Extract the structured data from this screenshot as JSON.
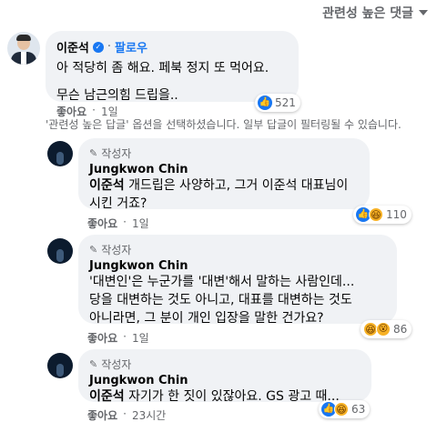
{
  "sort": {
    "label": "관련성 높은 댓글"
  },
  "main_comment": {
    "author": "이준석",
    "follow_label": "팔로우",
    "line1": "아 적당히 좀 해요. 페북 정지 또 먹어요.",
    "line2": "무슨 남근의힘 드립을..",
    "reaction_count": "521",
    "like_label": "좋아요",
    "time": "1일"
  },
  "notice": "'관련성 높은 답글' 옵션을 선택하셨습니다. 일부 답글이 필터링될 수 있습니다.",
  "replies": [
    {
      "author_badge": "작성자",
      "author": "Jungkwon Chin",
      "mention": "이준석",
      "line1_rest": " 개드립은 사양하고, 그거 이준석 대표님이",
      "line2": "시킨 거죠?",
      "reaction_count": "110",
      "like_label": "좋아요",
      "time": "1일"
    },
    {
      "author_badge": "작성자",
      "author": "Jungkwon Chin",
      "line1": "'대변인'은 누군가를 '대변'해서 말하는 사람인데...",
      "line2": "당을 대변하는 것도 아니고, 대표를 대변하는 것도",
      "line3": "아니라면, 그 분이 개인 입장을 말한 건가요?",
      "reaction_count": "86",
      "like_label": "좋아요",
      "time": "1일"
    },
    {
      "author_badge": "작성자",
      "author": "Jungkwon Chin",
      "mention": "이준석",
      "line1_rest": " 자기가 한 짓이 있잖아요. GS 광고 때...",
      "reaction_count": "63",
      "like_label": "좋아요",
      "time": "23시간"
    }
  ],
  "icons": {
    "like": "👍",
    "haha": "😆",
    "wow": "😮"
  }
}
